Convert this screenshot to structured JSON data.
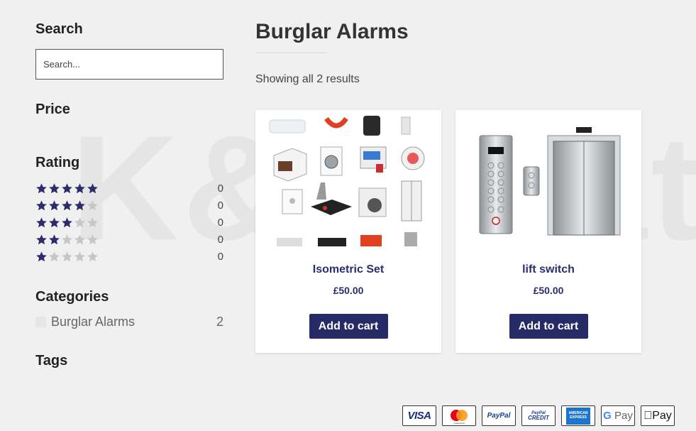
{
  "watermark": "K&M Fat",
  "sidebar": {
    "search_title": "Search",
    "search_placeholder": "Search...",
    "price_title": "Price",
    "rating_title": "Rating",
    "ratings": [
      {
        "stars": 5,
        "count": "0"
      },
      {
        "stars": 4,
        "count": "0"
      },
      {
        "stars": 3,
        "count": "0"
      },
      {
        "stars": 2,
        "count": "0"
      },
      {
        "stars": 1,
        "count": "0"
      }
    ],
    "categories_title": "Categories",
    "categories": [
      {
        "label": "Burglar Alarms",
        "count": "2"
      }
    ],
    "tags_title": "Tags"
  },
  "main": {
    "title": "Burglar Alarms",
    "result_count": "Showing all 2 results",
    "products": [
      {
        "name": "Isometric Set",
        "price": "£50.00",
        "button": "Add to cart",
        "image": "isometric-appliances-image"
      },
      {
        "name": "lift switch",
        "price": "£50.00",
        "button": "Add to cart",
        "image": "elevator-image"
      }
    ]
  },
  "payments": {
    "visa": "VISA",
    "mastercard": "mastercard",
    "paypal": "PayPal",
    "paypal_credit_top": "PayPal",
    "paypal_credit_bottom": "CREDIT",
    "amex": "AMERICAN EXPRESS",
    "gpay_g": "G",
    "gpay_text": "Pay",
    "applepay": "Pay"
  },
  "colors": {
    "accent": "#262a66",
    "star_full": "#2b2e6b",
    "star_empty": "#c6c6c6",
    "background": "#f0f0f0"
  }
}
